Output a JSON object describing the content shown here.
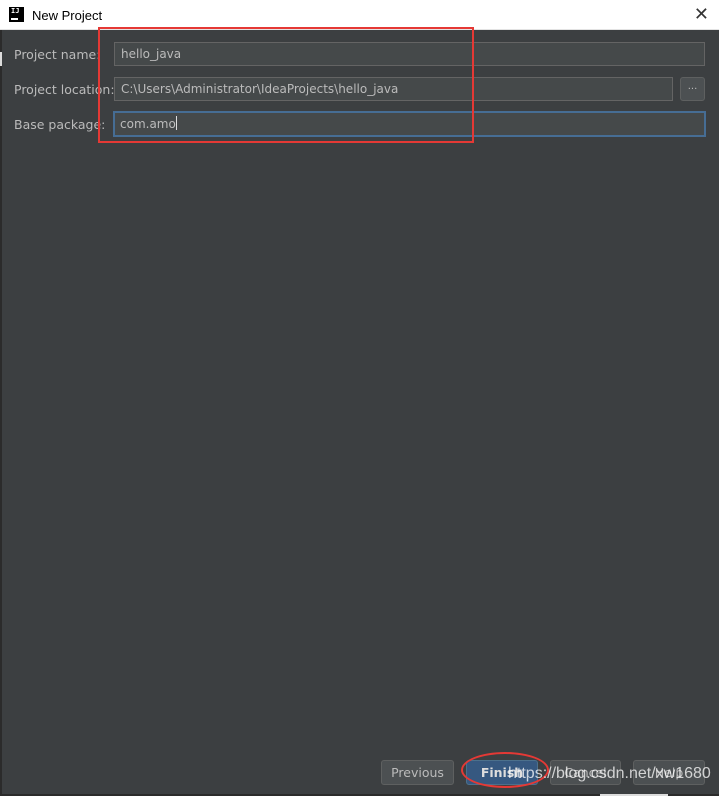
{
  "window": {
    "app_icon": "IJ",
    "title": "New Project",
    "close_glyph": "✕"
  },
  "form": {
    "project_name": {
      "label": "Project name:",
      "value": "hello_java"
    },
    "project_location": {
      "label": "Project location:",
      "value": "C:\\Users\\Administrator\\IdeaProjects\\hello_java",
      "browse_label": "..."
    },
    "base_package": {
      "label": "Base package:",
      "value": "com.amo"
    }
  },
  "buttons": {
    "previous": "Previous",
    "finish": "Finish",
    "cancel": "Cancel",
    "help": "Help"
  },
  "watermark": "https://blog.csdn.net/xw1680",
  "colors": {
    "background": "#3c3f41",
    "field_background": "#45494a",
    "focus_border": "#466d94",
    "default_button": "#365880",
    "annotation": "#e53935"
  }
}
